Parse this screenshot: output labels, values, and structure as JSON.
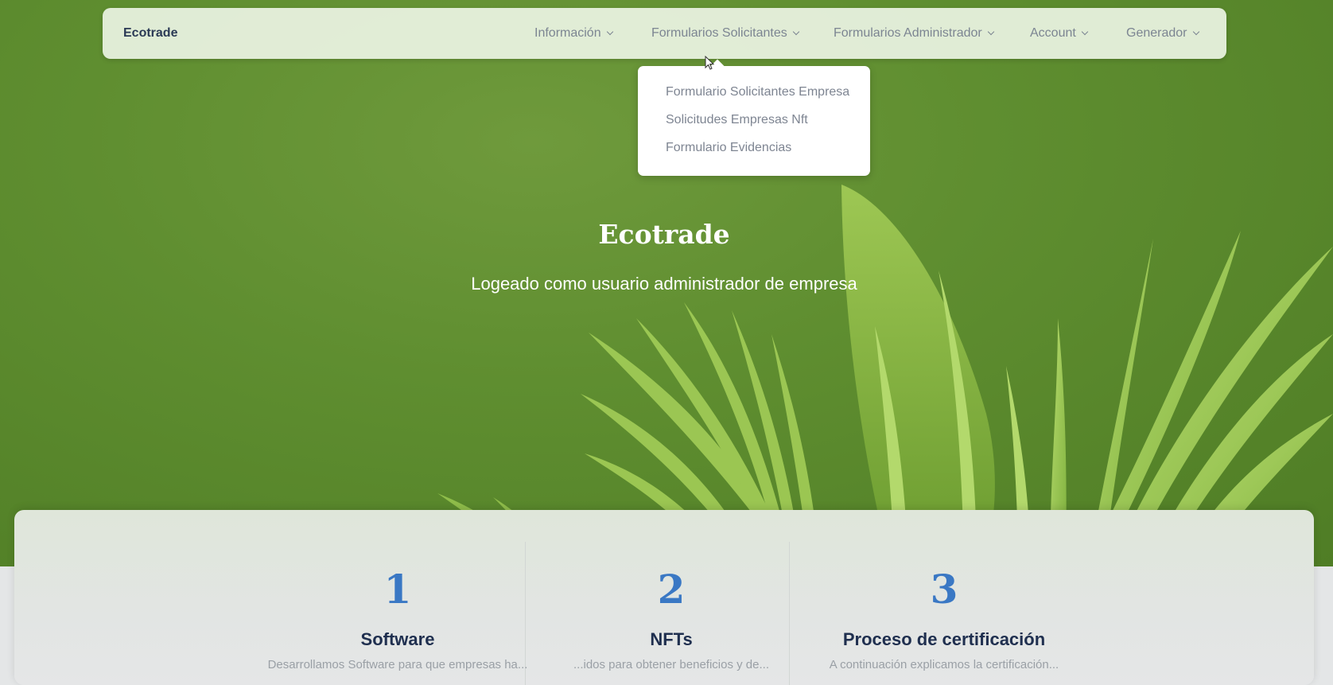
{
  "navbar": {
    "brand": "Ecotrade",
    "items": [
      {
        "label": "Información"
      },
      {
        "label": "Formularios Solicitantes"
      },
      {
        "label": "Formularios Administrador"
      },
      {
        "label": "Account"
      },
      {
        "label": "Generador"
      }
    ]
  },
  "dropdown": {
    "items": [
      {
        "label": "Formulario Solicitantes Empresa"
      },
      {
        "label": "Solicitudes Empresas Nft"
      },
      {
        "label": "Formulario Evidencias"
      }
    ]
  },
  "hero": {
    "title": "Ecotrade",
    "subtitle": "Logeado como usuario administrador de empresa"
  },
  "features": [
    {
      "number": "1",
      "title": "Software",
      "text": "Desarrollamos Software para que empresas ha..."
    },
    {
      "number": "2",
      "title": "NFTs",
      "text": "...idos para obtener beneficios y de..."
    },
    {
      "number": "3",
      "title": "Proceso de certificación",
      "text": "A continuación explicamos la certificación..."
    }
  ],
  "colors": {
    "hero_green": "#5f8e30",
    "leaf_light": "#a7cf5f",
    "feature_number": "#3a78c4",
    "feature_title": "#1f2f4f"
  }
}
